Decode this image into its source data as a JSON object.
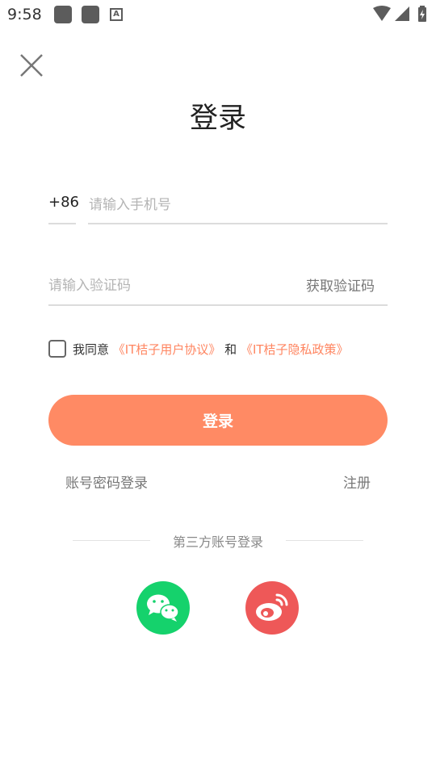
{
  "status_bar": {
    "time": "9:58",
    "a_badge": "A"
  },
  "header": {
    "title": "登录"
  },
  "phone": {
    "country_code": "+86",
    "placeholder": "请输入手机号"
  },
  "code": {
    "placeholder": "请输入验证码",
    "get_code_label": "获取验证码"
  },
  "agreement": {
    "prefix": "我同意",
    "user_agreement": "《IT桔子用户协议》",
    "conjunction": "和",
    "privacy_policy": "《IT桔子隐私政策》"
  },
  "login_button": "登录",
  "links": {
    "password_login": "账号密码登录",
    "register": "注册"
  },
  "third_party": {
    "label": "第三方账号登录",
    "providers": [
      {
        "icon": "wechat-icon",
        "color": "#15d26c"
      },
      {
        "icon": "weibo-icon",
        "color": "#ee5858"
      }
    ]
  },
  "colors": {
    "accent": "#ff8a64",
    "link": "#ff8560"
  }
}
